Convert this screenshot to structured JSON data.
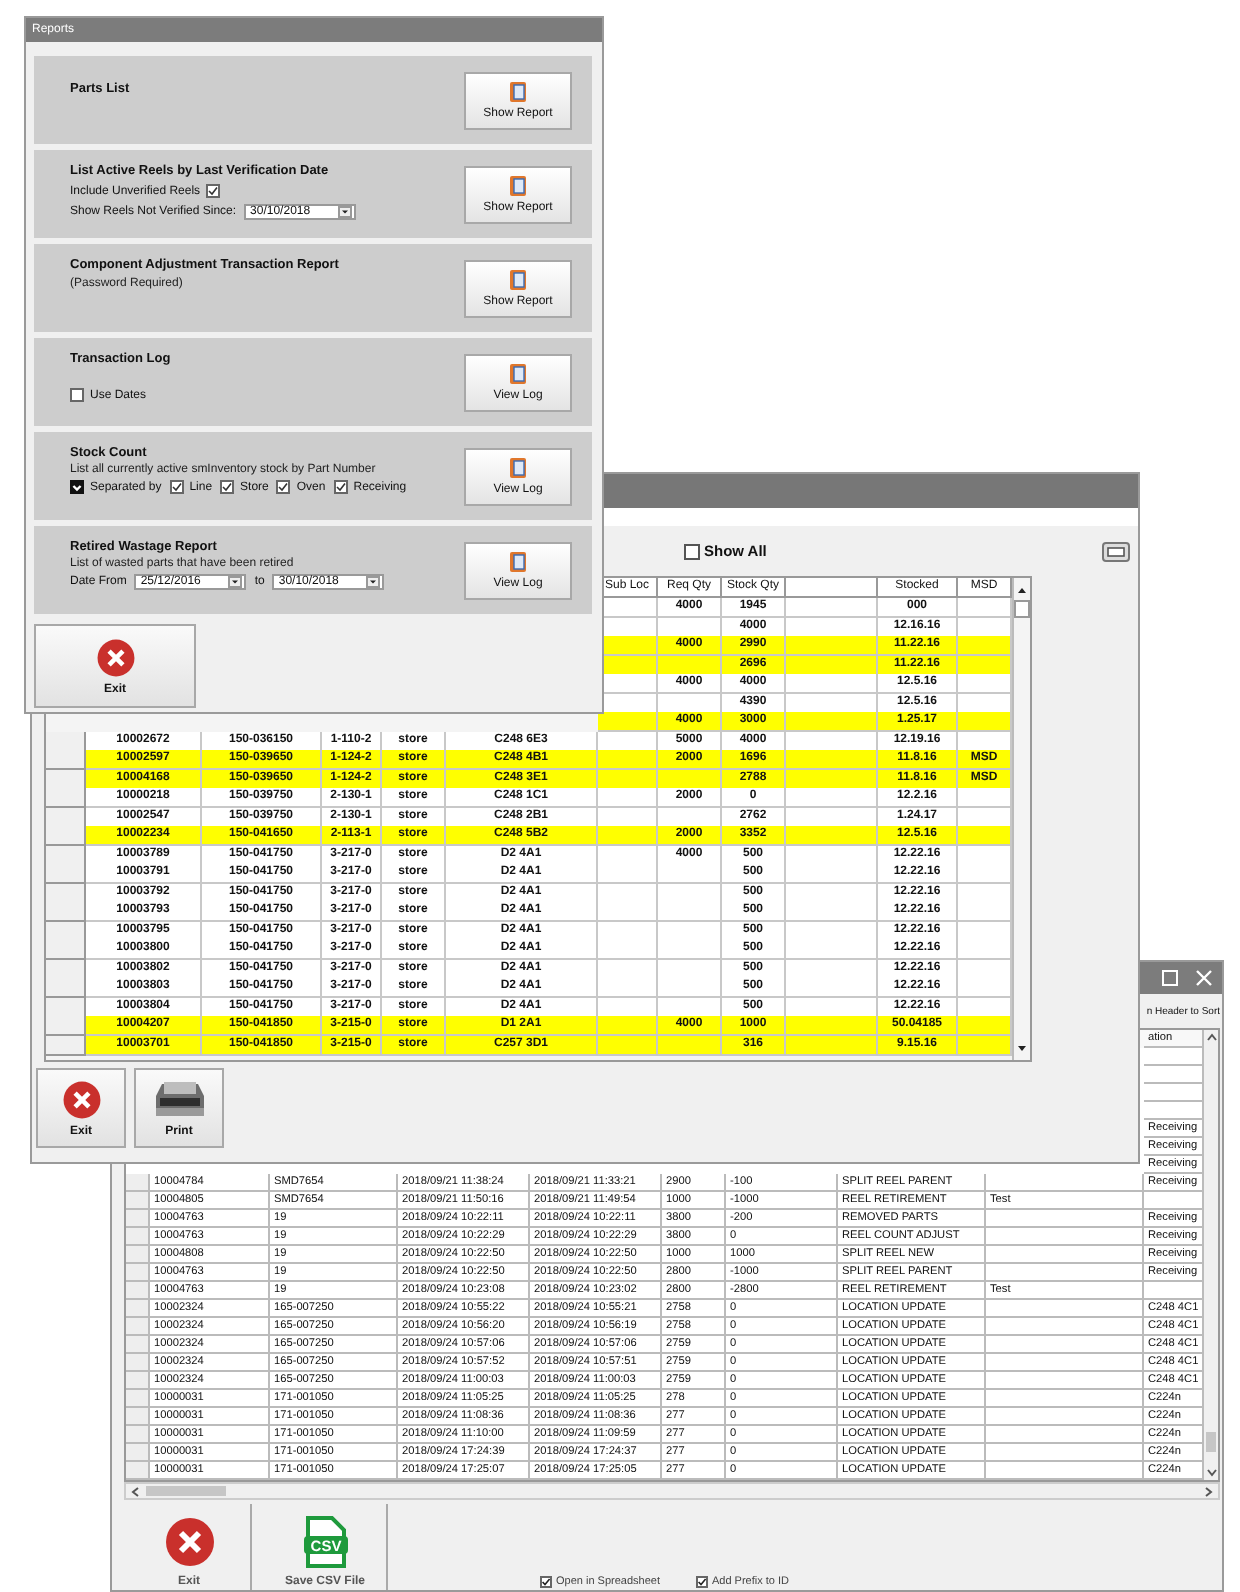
{
  "reports_window": {
    "title": "Reports",
    "sections": [
      {
        "kind": "plain",
        "title": "Parts List",
        "button": "Show Report"
      },
      {
        "kind": "verification",
        "title": "List Active Reels by Last Verification Date",
        "include": {
          "label": "Include Unverified Reels",
          "checked": true
        },
        "since_label": "Show Reels Not Verified Since:",
        "since_date": "30/10/2018",
        "button": "Show Report"
      },
      {
        "kind": "note",
        "title": "Component Adjustment Transaction Report",
        "note": "(Password Required)",
        "button": "Show Report"
      },
      {
        "kind": "log",
        "title": "Transaction Log",
        "use_dates": {
          "label": "Use Dates",
          "checked": false
        },
        "button": "View Log"
      },
      {
        "kind": "stock",
        "title": "Stock Count",
        "description": "List all currently active smInventory stock by Part Number",
        "separated": {
          "label": "Separated by",
          "checked": true
        },
        "options": [
          {
            "label": "Line",
            "checked": true
          },
          {
            "label": "Store",
            "checked": true
          },
          {
            "label": "Oven",
            "checked": true
          },
          {
            "label": "Receiving",
            "checked": true
          }
        ],
        "button": "View Log"
      },
      {
        "kind": "wastage",
        "title": "Retired Wastage Report",
        "description": "List of wasted parts that have been retired",
        "from_label": "Date  From",
        "from_date": "25/12/2016",
        "to_label": "to",
        "to_date": "30/10/2018",
        "button": "View Log"
      }
    ],
    "exit_button": "Exit"
  },
  "stock_window": {
    "show_all": {
      "label": "Show All",
      "checked": false
    },
    "headers": {
      "sub_loc": "Sub Loc",
      "req_qty": "Req Qty",
      "stock_qty": "Stock Qty",
      "stocked": "Stocked",
      "msd": "MSD"
    },
    "rows": [
      {
        "highlighted": false,
        "req_qty": "4000",
        "stock_qty": "1945",
        "stocked": "000"
      },
      {
        "highlighted": false,
        "stock_qty": "4000",
        "stocked": "12.16.16"
      },
      {
        "highlighted": true,
        "req_qty": "4000",
        "stock_qty": "2990",
        "stocked": "11.22.16"
      },
      {
        "highlighted": true,
        "stock_qty": "2696",
        "stocked": "11.22.16"
      },
      {
        "highlighted": false,
        "req_qty": "4000",
        "stock_qty": "4000",
        "stocked": "12.5.16"
      },
      {
        "highlighted": false,
        "stock_qty": "4390",
        "stocked": "12.5.16"
      },
      {
        "highlighted": true,
        "req_qty": "4000",
        "stock_qty": "3000",
        "stocked": "1.25.17"
      },
      {
        "highlighted": false,
        "id": "10002672",
        "part": "150-036150",
        "loc": "1-110-2",
        "area": "store",
        "location": "C248 6E3",
        "req_qty": "5000",
        "stock_qty": "4000",
        "stocked": "12.19.16"
      },
      {
        "highlighted": true,
        "id": "10002597",
        "part": "150-039650",
        "loc": "1-124-2",
        "area": "store",
        "location": "C248 4B1",
        "req_qty": "2000",
        "stock_qty": "1696",
        "stocked": "11.8.16",
        "msd": "MSD"
      },
      {
        "highlighted": true,
        "id": "10004168",
        "part": "150-039650",
        "loc": "1-124-2",
        "area": "store",
        "location": "C248 3E1",
        "stock_qty": "2788",
        "stocked": "11.8.16",
        "msd": "MSD"
      },
      {
        "highlighted": false,
        "id": "10000218",
        "part": "150-039750",
        "loc": "2-130-1",
        "area": "store",
        "location": "C248 1C1",
        "req_qty": "2000",
        "stock_qty": "0",
        "stocked": "12.2.16"
      },
      {
        "highlighted": false,
        "id": "10002547",
        "part": "150-039750",
        "loc": "2-130-1",
        "area": "store",
        "location": "C248 2B1",
        "stock_qty": "2762",
        "stocked": "1.24.17"
      },
      {
        "highlighted": true,
        "id": "10002234",
        "part": "150-041650",
        "loc": "2-113-1",
        "area": "store",
        "location": "C248 5B2",
        "req_qty": "2000",
        "stock_qty": "3352",
        "stocked": "12.5.16"
      },
      {
        "highlighted": false,
        "id": "10003789",
        "part": "150-041750",
        "loc": "3-217-0",
        "area": "store",
        "location": "D2 4A1",
        "req_qty": "4000",
        "stock_qty": "500",
        "stocked": "12.22.16"
      },
      {
        "highlighted": false,
        "id": "10003791",
        "part": "150-041750",
        "loc": "3-217-0",
        "area": "store",
        "location": "D2 4A1",
        "stock_qty": "500",
        "stocked": "12.22.16"
      },
      {
        "highlighted": false,
        "id": "10003792",
        "part": "150-041750",
        "loc": "3-217-0",
        "area": "store",
        "location": "D2 4A1",
        "stock_qty": "500",
        "stocked": "12.22.16"
      },
      {
        "highlighted": false,
        "id": "10003793",
        "part": "150-041750",
        "loc": "3-217-0",
        "area": "store",
        "location": "D2 4A1",
        "stock_qty": "500",
        "stocked": "12.22.16"
      },
      {
        "highlighted": false,
        "id": "10003795",
        "part": "150-041750",
        "loc": "3-217-0",
        "area": "store",
        "location": "D2 4A1",
        "stock_qty": "500",
        "stocked": "12.22.16"
      },
      {
        "highlighted": false,
        "id": "10003800",
        "part": "150-041750",
        "loc": "3-217-0",
        "area": "store",
        "location": "D2 4A1",
        "stock_qty": "500",
        "stocked": "12.22.16"
      },
      {
        "highlighted": false,
        "id": "10003802",
        "part": "150-041750",
        "loc": "3-217-0",
        "area": "store",
        "location": "D2 4A1",
        "stock_qty": "500",
        "stocked": "12.22.16"
      },
      {
        "highlighted": false,
        "id": "10003803",
        "part": "150-041750",
        "loc": "3-217-0",
        "area": "store",
        "location": "D2 4A1",
        "stock_qty": "500",
        "stocked": "12.22.16"
      },
      {
        "highlighted": false,
        "id": "10003804",
        "part": "150-041750",
        "loc": "3-217-0",
        "area": "store",
        "location": "D2 4A1",
        "stock_qty": "500",
        "stocked": "12.22.16"
      },
      {
        "highlighted": true,
        "id": "10004207",
        "part": "150-041850",
        "loc": "3-215-0",
        "area": "store",
        "location": "D1 2A1",
        "req_qty": "4000",
        "stock_qty": "1000",
        "stocked": "50.04185"
      },
      {
        "highlighted": true,
        "id": "10003701",
        "part": "150-041850",
        "loc": "3-215-0",
        "area": "store",
        "location": "C257 3D1",
        "stock_qty": "316",
        "stocked": "9.15.16"
      }
    ],
    "exit_button": "Exit",
    "print_button": "Print"
  },
  "log_window": {
    "hint": "n Header to Sort",
    "last_column": "ation",
    "rows": [
      {},
      {},
      {},
      {},
      {
        "location": "Receiving"
      },
      {
        "location": "Receiving"
      },
      {
        "location": "Receiving"
      },
      {
        "reel": "10004784",
        "part": "SMD7654",
        "logged": "2018/09/21 11:38:24",
        "scanned": "2018/09/21 11:33:21",
        "qty": "2900",
        "change": "-100",
        "action": "SPLIT REEL PARENT",
        "location": "Receiving"
      },
      {
        "reel": "10004805",
        "part": "SMD7654",
        "logged": "2018/09/21 11:50:16",
        "scanned": "2018/09/21 11:49:54",
        "qty": "1000",
        "change": "-1000",
        "action": "REEL RETIREMENT",
        "note": "Test"
      },
      {
        "reel": "10004763",
        "part": "19",
        "logged": "2018/09/24 10:22:11",
        "scanned": "2018/09/24 10:22:11",
        "qty": "3800",
        "change": "-200",
        "action": "REMOVED PARTS",
        "location": "Receiving"
      },
      {
        "reel": "10004763",
        "part": "19",
        "logged": "2018/09/24 10:22:29",
        "scanned": "2018/09/24 10:22:29",
        "qty": "3800",
        "change": "0",
        "action": "REEL COUNT ADJUST",
        "location": "Receiving"
      },
      {
        "reel": "10004808",
        "part": "19",
        "logged": "2018/09/24 10:22:50",
        "scanned": "2018/09/24 10:22:50",
        "qty": "1000",
        "change": "1000",
        "action": "SPLIT REEL NEW",
        "location": "Receiving"
      },
      {
        "reel": "10004763",
        "part": "19",
        "logged": "2018/09/24 10:22:50",
        "scanned": "2018/09/24 10:22:50",
        "qty": "2800",
        "change": "-1000",
        "action": "SPLIT REEL PARENT",
        "location": "Receiving"
      },
      {
        "reel": "10004763",
        "part": "19",
        "logged": "2018/09/24 10:23:08",
        "scanned": "2018/09/24 10:23:02",
        "qty": "2800",
        "change": "-2800",
        "action": "REEL RETIREMENT",
        "note": "Test"
      },
      {
        "reel": "10002324",
        "part": "165-007250",
        "logged": "2018/09/24 10:55:22",
        "scanned": "2018/09/24 10:55:21",
        "qty": "2758",
        "change": "0",
        "action": "LOCATION UPDATE",
        "location": "C248 4C1"
      },
      {
        "reel": "10002324",
        "part": "165-007250",
        "logged": "2018/09/24 10:56:20",
        "scanned": "2018/09/24 10:56:19",
        "qty": "2758",
        "change": "0",
        "action": "LOCATION UPDATE",
        "location": "C248 4C1"
      },
      {
        "reel": "10002324",
        "part": "165-007250",
        "logged": "2018/09/24 10:57:06",
        "scanned": "2018/09/24 10:57:06",
        "qty": "2759",
        "change": "0",
        "action": "LOCATION UPDATE",
        "location": "C248 4C1"
      },
      {
        "reel": "10002324",
        "part": "165-007250",
        "logged": "2018/09/24 10:57:52",
        "scanned": "2018/09/24 10:57:51",
        "qty": "2759",
        "change": "0",
        "action": "LOCATION UPDATE",
        "location": "C248 4C1"
      },
      {
        "reel": "10002324",
        "part": "165-007250",
        "logged": "2018/09/24 11:00:03",
        "scanned": "2018/09/24 11:00:03",
        "qty": "2759",
        "change": "0",
        "action": "LOCATION UPDATE",
        "location": "C248 4C1"
      },
      {
        "reel": "10000031",
        "part": "171-001050",
        "logged": "2018/09/24 11:05:25",
        "scanned": "2018/09/24 11:05:25",
        "qty": "278",
        "change": "0",
        "action": "LOCATION UPDATE",
        "location": "C224n"
      },
      {
        "reel": "10000031",
        "part": "171-001050",
        "logged": "2018/09/24 11:08:36",
        "scanned": "2018/09/24 11:08:36",
        "qty": "277",
        "change": "0",
        "action": "LOCATION UPDATE",
        "location": "C224n"
      },
      {
        "reel": "10000031",
        "part": "171-001050",
        "logged": "2018/09/24 11:10:00",
        "scanned": "2018/09/24 11:09:59",
        "qty": "277",
        "change": "0",
        "action": "LOCATION UPDATE",
        "location": "C224n"
      },
      {
        "reel": "10000031",
        "part": "171-001050",
        "logged": "2018/09/24 17:24:39",
        "scanned": "2018/09/24 17:24:37",
        "qty": "277",
        "change": "0",
        "action": "LOCATION UPDATE",
        "location": "C224n"
      },
      {
        "reel": "10000031",
        "part": "171-001050",
        "logged": "2018/09/24 17:25:07",
        "scanned": "2018/09/24 17:25:05",
        "qty": "277",
        "change": "0",
        "action": "LOCATION UPDATE",
        "location": "C224n"
      }
    ],
    "exit_button": "Exit",
    "csv_icon": "CSV",
    "save_button": "Save CSV File",
    "options": [
      {
        "label": "Open in Spreadsheet",
        "checked": true
      },
      {
        "label": "Add Prefix to ID",
        "checked": true
      }
    ]
  }
}
